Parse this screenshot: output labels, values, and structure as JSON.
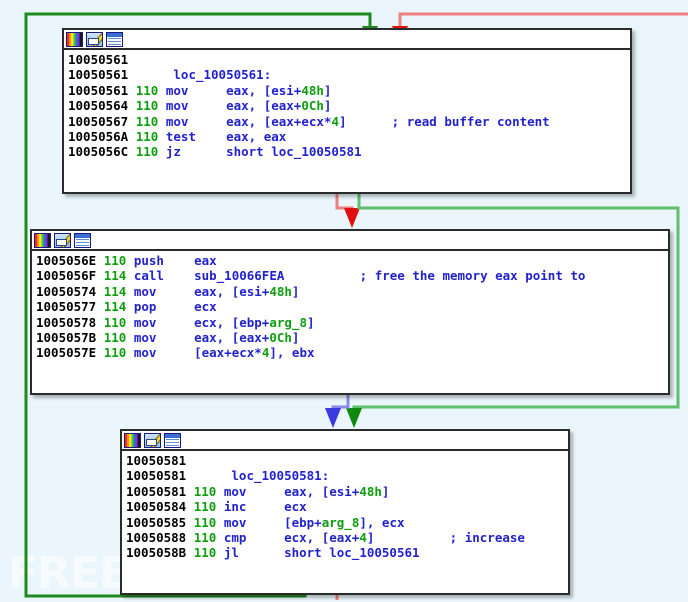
{
  "app": {
    "view": "IDA Pro Graph View",
    "watermark": "FREEBUF",
    "background_color": "#eaf6fb",
    "node_border_color": "#2b2b2b",
    "node_background_color": "#ffffff"
  },
  "titlebar_icons": [
    {
      "name": "palette-icon",
      "label": "palette"
    },
    {
      "name": "edit-image-icon",
      "label": "edit"
    },
    {
      "name": "window-icon",
      "label": "window"
    }
  ],
  "colors": {
    "address": "#000000",
    "stack_depth": "#0f9e0f",
    "mnemonic": "#2222cc",
    "operand": "#2222cc",
    "number": "#0f9e0f",
    "comment": "#2222cc",
    "label": "#2222cc",
    "edge_green": "#1f8a1f",
    "edge_green_light": "#5fbf6a",
    "edge_red": "#e01010",
    "edge_red_light": "#f08080",
    "edge_blue": "#3a3ae0",
    "edge_blue_light": "#8a8ae8"
  },
  "blocks": [
    {
      "id": "block-1",
      "label": "loc_10050561",
      "lines": [
        {
          "addr": "10050561",
          "depth": "",
          "mnem": "",
          "ops": "",
          "cmt": "",
          "label": ""
        },
        {
          "addr": "10050561",
          "depth": "",
          "mnem": "",
          "ops": "",
          "cmt": "",
          "label": "loc_10050561:"
        },
        {
          "addr": "10050561",
          "depth": "110",
          "mnem": "mov",
          "ops": "eax, [esi+48h]",
          "cmt": "",
          "label": ""
        },
        {
          "addr": "10050564",
          "depth": "110",
          "mnem": "mov",
          "ops": "eax, [eax+0Ch]",
          "cmt": "",
          "label": ""
        },
        {
          "addr": "10050567",
          "depth": "110",
          "mnem": "mov",
          "ops": "eax, [eax+ecx*4]",
          "cmt": "; read buffer content",
          "label": ""
        },
        {
          "addr": "1005056A",
          "depth": "110",
          "mnem": "test",
          "ops": "eax, eax",
          "cmt": "",
          "label": ""
        },
        {
          "addr": "1005056C",
          "depth": "110",
          "mnem": "jz",
          "ops": "short loc_10050581",
          "cmt": "",
          "label": ""
        }
      ]
    },
    {
      "id": "block-2",
      "label": "",
      "lines": [
        {
          "addr": "1005056E",
          "depth": "110",
          "mnem": "push",
          "ops": "eax",
          "cmt": "",
          "label": ""
        },
        {
          "addr": "1005056F",
          "depth": "114",
          "mnem": "call",
          "ops": "sub_10066FEA",
          "cmt": "; free the memory eax point to",
          "label": ""
        },
        {
          "addr": "10050574",
          "depth": "114",
          "mnem": "mov",
          "ops": "eax, [esi+48h]",
          "cmt": "",
          "label": ""
        },
        {
          "addr": "10050577",
          "depth": "114",
          "mnem": "pop",
          "ops": "ecx",
          "cmt": "",
          "label": ""
        },
        {
          "addr": "10050578",
          "depth": "110",
          "mnem": "mov",
          "ops": "ecx, [ebp+arg_8]",
          "cmt": "",
          "label": ""
        },
        {
          "addr": "1005057B",
          "depth": "110",
          "mnem": "mov",
          "ops": "eax, [eax+0Ch]",
          "cmt": "",
          "label": ""
        },
        {
          "addr": "1005057E",
          "depth": "110",
          "mnem": "mov",
          "ops": "[eax+ecx*4], ebx",
          "cmt": "",
          "label": ""
        }
      ]
    },
    {
      "id": "block-3",
      "label": "loc_10050581",
      "lines": [
        {
          "addr": "10050581",
          "depth": "",
          "mnem": "",
          "ops": "",
          "cmt": "",
          "label": ""
        },
        {
          "addr": "10050581",
          "depth": "",
          "mnem": "",
          "ops": "",
          "cmt": "",
          "label": "loc_10050581:"
        },
        {
          "addr": "10050581",
          "depth": "110",
          "mnem": "mov",
          "ops": "eax, [esi+48h]",
          "cmt": "",
          "label": ""
        },
        {
          "addr": "10050584",
          "depth": "110",
          "mnem": "inc",
          "ops": "ecx",
          "cmt": "",
          "label": ""
        },
        {
          "addr": "10050585",
          "depth": "110",
          "mnem": "mov",
          "ops": "[ebp+arg_8], ecx",
          "cmt": "",
          "label": ""
        },
        {
          "addr": "10050588",
          "depth": "110",
          "mnem": "cmp",
          "ops": "ecx, [eax+4]",
          "cmt": "; increase",
          "label": ""
        },
        {
          "addr": "1005058B",
          "depth": "110",
          "mnem": "jl",
          "ops": "short loc_10050561",
          "cmt": "",
          "label": ""
        }
      ]
    }
  ],
  "edges": [
    {
      "name": "edge-block1-false-to-block2",
      "color": "#e01010",
      "kind": "conditional-false"
    },
    {
      "name": "edge-block1-true-to-block3",
      "color": "#1f8a1f",
      "kind": "conditional-true"
    },
    {
      "name": "edge-block2-to-block3",
      "color": "#3a3ae0",
      "kind": "unconditional"
    },
    {
      "name": "edge-block3-true-to-block1",
      "color": "#1f8a1f",
      "kind": "loop-back-true"
    },
    {
      "name": "edge-block3-false-out",
      "color": "#e01010",
      "kind": "conditional-false-exit"
    }
  ]
}
